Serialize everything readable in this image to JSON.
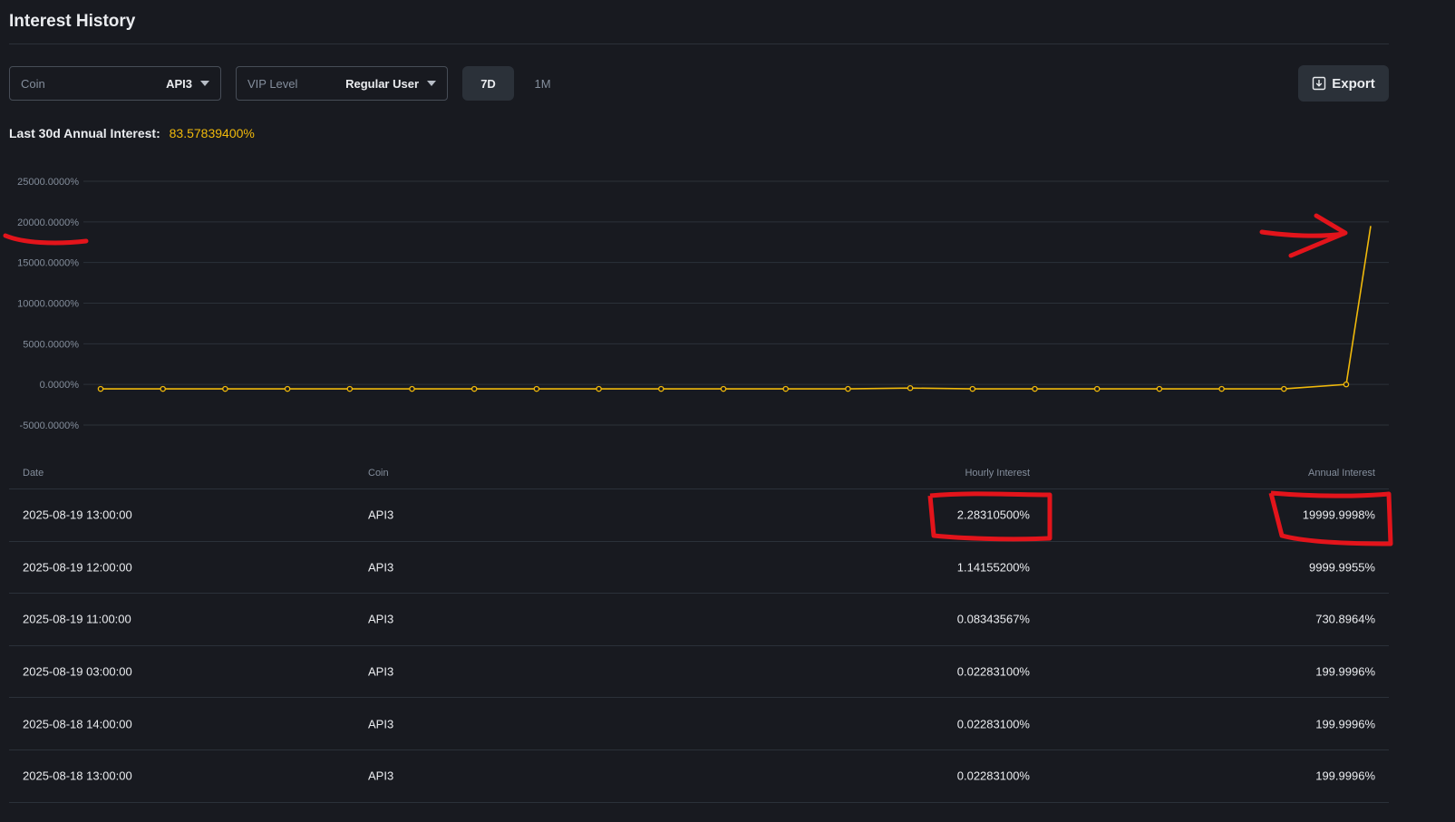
{
  "header": {
    "title": "Interest History"
  },
  "filters": {
    "coin_label": "Coin",
    "coin_value": "API3",
    "vip_label": "VIP Level",
    "vip_value": "Regular User",
    "ranges": [
      "7D",
      "1M"
    ],
    "selected_range": "7D",
    "export_label": "Export"
  },
  "summary": {
    "label": "Last 30d Annual Interest:",
    "value": "83.57839400%"
  },
  "colors": {
    "accent": "#f0b90b",
    "background": "#181a20",
    "annotation": "#e3141b"
  },
  "chart_data": {
    "type": "line",
    "yaxis_ticks": [
      "25000.0000%",
      "20000.0000%",
      "15000.0000%",
      "10000.0000%",
      "5000.0000%",
      "0.0000%",
      "-5000.0000%"
    ],
    "ylim": [
      -5000,
      25000
    ],
    "grid": true,
    "series": [
      {
        "values": [
          -550,
          -550,
          -550,
          -550,
          -550,
          -550,
          -550,
          -550,
          -550,
          -550,
          -550,
          -550,
          -550,
          -450,
          -550,
          -550,
          -550,
          -550,
          -550,
          -550,
          0,
          19500
        ],
        "markers": [
          true,
          true,
          true,
          true,
          true,
          true,
          true,
          true,
          true,
          true,
          true,
          true,
          true,
          true,
          true,
          true,
          true,
          true,
          true,
          true,
          true,
          false
        ]
      }
    ]
  },
  "table": {
    "columns": [
      "Date",
      "Coin",
      "Hourly Interest",
      "Annual Interest"
    ],
    "rows": [
      {
        "date": "2025-08-19 13:00:00",
        "coin": "API3",
        "hourly": "2.28310500%",
        "annual": "19999.9998%"
      },
      {
        "date": "2025-08-19 12:00:00",
        "coin": "API3",
        "hourly": "1.14155200%",
        "annual": "9999.9955%"
      },
      {
        "date": "2025-08-19 11:00:00",
        "coin": "API3",
        "hourly": "0.08343567%",
        "annual": "730.8964%"
      },
      {
        "date": "2025-08-19 03:00:00",
        "coin": "API3",
        "hourly": "0.02283100%",
        "annual": "199.9996%"
      },
      {
        "date": "2025-08-18 14:00:00",
        "coin": "API3",
        "hourly": "0.02283100%",
        "annual": "199.9996%"
      },
      {
        "date": "2025-08-18 13:00:00",
        "coin": "API3",
        "hourly": "0.02283100%",
        "annual": "199.9996%"
      }
    ]
  }
}
